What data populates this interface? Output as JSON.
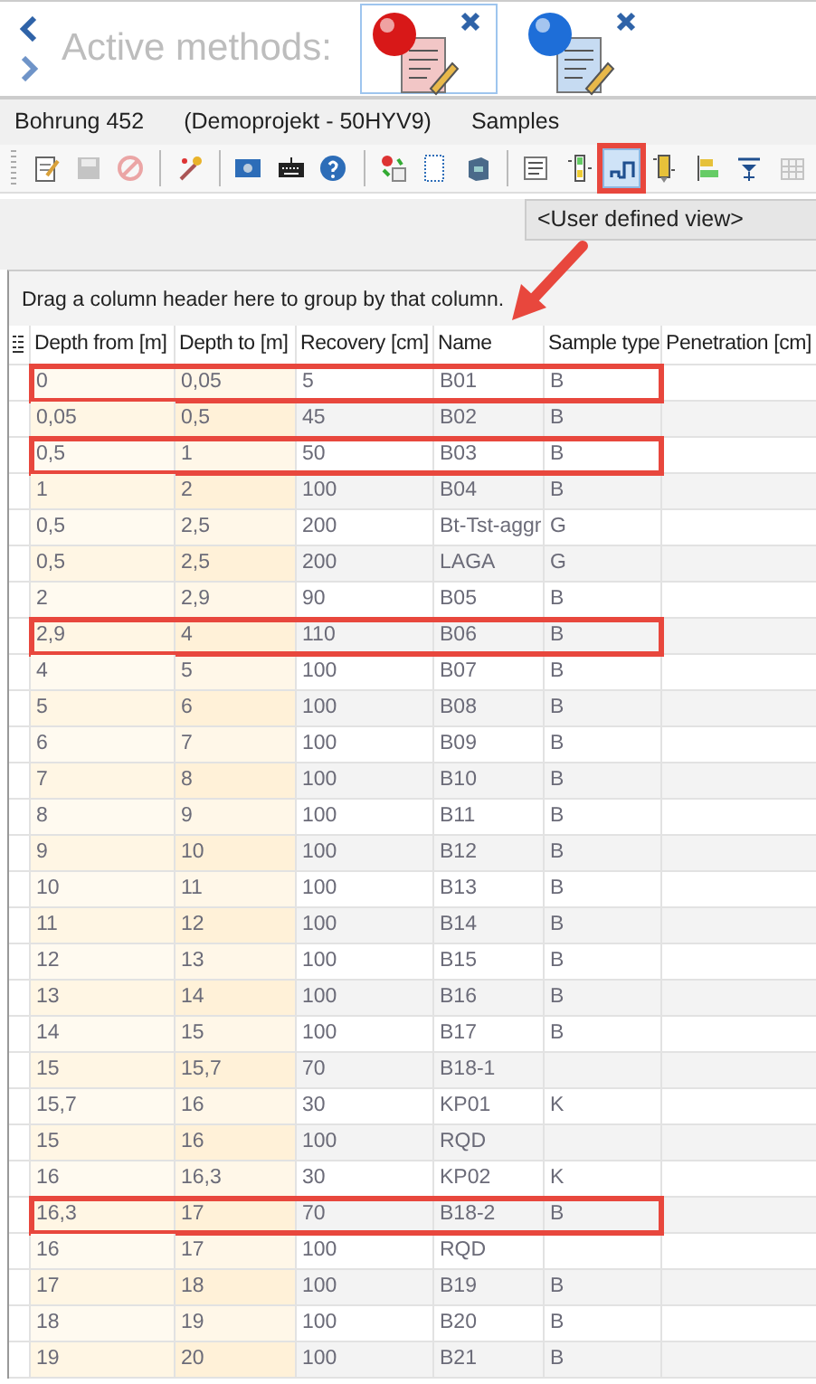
{
  "header": {
    "title": "Active methods:",
    "methods": [
      {
        "color": "#d81818",
        "selected": true
      },
      {
        "color": "#1e6ed8",
        "selected": false
      }
    ]
  },
  "breadcrumb": [
    "Bohrung 452",
    "(Demoprojekt - 50HYV9)",
    "Samples"
  ],
  "toolbar": [
    [
      {
        "kind": "notepad",
        "disabled": false,
        "selected": false
      },
      {
        "kind": "save",
        "disabled": true,
        "selected": false
      },
      {
        "kind": "cancel",
        "disabled": true,
        "selected": false
      }
    ],
    [
      {
        "kind": "wand",
        "disabled": false,
        "selected": false
      }
    ],
    [
      {
        "kind": "monitor",
        "disabled": false,
        "selected": false
      },
      {
        "kind": "keyboard",
        "disabled": false,
        "selected": false
      },
      {
        "kind": "help",
        "disabled": false,
        "selected": false
      }
    ],
    [
      {
        "kind": "pin-doc",
        "disabled": false,
        "selected": false
      },
      {
        "kind": "page",
        "disabled": false,
        "selected": false
      },
      {
        "kind": "cabinet",
        "disabled": false,
        "selected": false
      }
    ],
    [
      {
        "kind": "list",
        "disabled": false,
        "selected": false
      },
      {
        "kind": "columns",
        "disabled": false,
        "selected": false
      },
      {
        "kind": "step",
        "disabled": false,
        "selected": true,
        "highlighted": true
      },
      {
        "kind": "sampler",
        "disabled": false,
        "selected": false
      },
      {
        "kind": "align",
        "disabled": false,
        "selected": false
      },
      {
        "kind": "filter",
        "disabled": false,
        "selected": false
      },
      {
        "kind": "grid",
        "disabled": true,
        "selected": false
      }
    ]
  ],
  "view_selector": {
    "value": "<User defined view>"
  },
  "grid": {
    "group_hint": "Drag a column header here to group by that column.",
    "columns": [
      "Depth from [m]",
      "Depth to [m]",
      "Recovery [cm]",
      "Name",
      "Sample type",
      "Penetration [cm]"
    ],
    "rows": [
      {
        "depth_from": "0",
        "depth_to": "0,05",
        "recovery": "5",
        "name": "B01",
        "sample_type": "B",
        "highlighted": true
      },
      {
        "depth_from": "0,05",
        "depth_to": "0,5",
        "recovery": "45",
        "name": "B02",
        "sample_type": "B",
        "highlighted": false
      },
      {
        "depth_from": "0,5",
        "depth_to": "1",
        "recovery": "50",
        "name": "B03",
        "sample_type": "B",
        "highlighted": true
      },
      {
        "depth_from": "1",
        "depth_to": "2",
        "recovery": "100",
        "name": "B04",
        "sample_type": "B",
        "highlighted": false
      },
      {
        "depth_from": "0,5",
        "depth_to": "2,5",
        "recovery": "200",
        "name": "Bt-Tst-aggr",
        "sample_type": "G",
        "highlighted": false
      },
      {
        "depth_from": "0,5",
        "depth_to": "2,5",
        "recovery": "200",
        "name": "LAGA",
        "sample_type": "G",
        "highlighted": false
      },
      {
        "depth_from": "2",
        "depth_to": "2,9",
        "recovery": "90",
        "name": "B05",
        "sample_type": "B",
        "highlighted": false
      },
      {
        "depth_from": "2,9",
        "depth_to": "4",
        "recovery": "110",
        "name": "B06",
        "sample_type": "B",
        "highlighted": true
      },
      {
        "depth_from": "4",
        "depth_to": "5",
        "recovery": "100",
        "name": "B07",
        "sample_type": "B",
        "highlighted": false
      },
      {
        "depth_from": "5",
        "depth_to": "6",
        "recovery": "100",
        "name": "B08",
        "sample_type": "B",
        "highlighted": false
      },
      {
        "depth_from": "6",
        "depth_to": "7",
        "recovery": "100",
        "name": "B09",
        "sample_type": "B",
        "highlighted": false
      },
      {
        "depth_from": "7",
        "depth_to": "8",
        "recovery": "100",
        "name": "B10",
        "sample_type": "B",
        "highlighted": false
      },
      {
        "depth_from": "8",
        "depth_to": "9",
        "recovery": "100",
        "name": "B11",
        "sample_type": "B",
        "highlighted": false
      },
      {
        "depth_from": "9",
        "depth_to": "10",
        "recovery": "100",
        "name": "B12",
        "sample_type": "B",
        "highlighted": false
      },
      {
        "depth_from": "10",
        "depth_to": "11",
        "recovery": "100",
        "name": "B13",
        "sample_type": "B",
        "highlighted": false
      },
      {
        "depth_from": "11",
        "depth_to": "12",
        "recovery": "100",
        "name": "B14",
        "sample_type": "B",
        "highlighted": false
      },
      {
        "depth_from": "12",
        "depth_to": "13",
        "recovery": "100",
        "name": "B15",
        "sample_type": "B",
        "highlighted": false
      },
      {
        "depth_from": "13",
        "depth_to": "14",
        "recovery": "100",
        "name": "B16",
        "sample_type": "B",
        "highlighted": false
      },
      {
        "depth_from": "14",
        "depth_to": "15",
        "recovery": "100",
        "name": "B17",
        "sample_type": "B",
        "highlighted": false
      },
      {
        "depth_from": "15",
        "depth_to": "15,7",
        "recovery": "70",
        "name": "B18-1",
        "highlighted": false
      },
      {
        "depth_from": "15,7",
        "depth_to": "16",
        "recovery": "30",
        "name": "KP01",
        "sample_type": "K",
        "highlighted": false
      },
      {
        "depth_from": "15",
        "depth_to": "16",
        "recovery": "100",
        "name": "RQD",
        "highlighted": false
      },
      {
        "depth_from": "16",
        "depth_to": "16,3",
        "recovery": "30",
        "name": "KP02",
        "sample_type": "K",
        "highlighted": false
      },
      {
        "depth_from": "16,3",
        "depth_to": "17",
        "recovery": "70",
        "name": "B18-2",
        "sample_type": "B",
        "highlighted": true
      },
      {
        "depth_from": "16",
        "depth_to": "17",
        "recovery": "100",
        "name": "RQD",
        "highlighted": false
      },
      {
        "depth_from": "17",
        "depth_to": "18",
        "recovery": "100",
        "name": "B19",
        "sample_type": "B",
        "highlighted": false
      },
      {
        "depth_from": "18",
        "depth_to": "19",
        "recovery": "100",
        "name": "B20",
        "sample_type": "B",
        "highlighted": false
      },
      {
        "depth_from": "19",
        "depth_to": "20",
        "recovery": "100",
        "name": "B21",
        "sample_type": "B",
        "highlighted": false
      }
    ]
  }
}
